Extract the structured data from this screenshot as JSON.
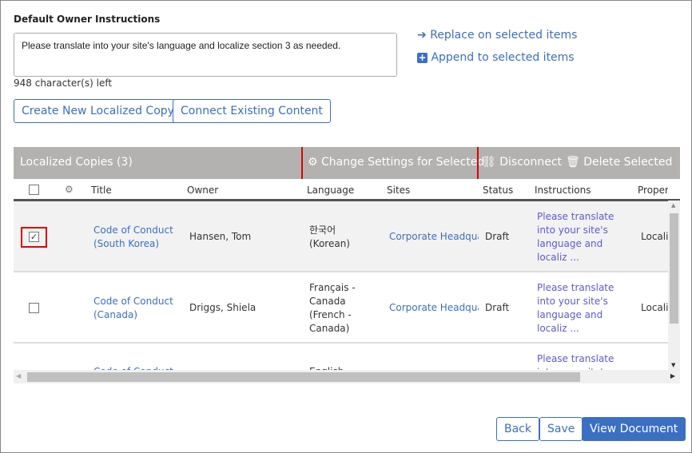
{
  "instructions": {
    "label": "Default Owner Instructions",
    "value": "Please translate into your site's language and localize section 3 as needed.",
    "chars_left": "948 character(s) left",
    "replace": "Replace on selected items",
    "append": "Append to selected items"
  },
  "buttons": {
    "create": "Create New Localized Copy",
    "connect": "Connect Existing Content",
    "back": "Back",
    "save": "Save",
    "view": "View Document"
  },
  "grid": {
    "title": "Localized Copies (3)",
    "change": "Change Settings for Selected",
    "disconnect": "Disconnect",
    "delete": "Delete Selected",
    "columns": [
      "Title",
      "Owner",
      "Language",
      "Sites",
      "Status",
      "Instructions",
      "Proper"
    ],
    "rows": [
      {
        "checked": true,
        "title": "Code of Conduct (South Korea)",
        "owner": "Hansen, Tom",
        "language": "한국어 (Korean)",
        "sites": "Corporate Headqua",
        "status": "Draft",
        "instructions": "Please translate into your site's language and localiz ...",
        "properties": "Locali"
      },
      {
        "checked": false,
        "title": "Code of Conduct (Canada)",
        "owner": "Driggs, Shiela",
        "language": "Français - Canada (French - Canada)",
        "sites": "Corporate Headqua",
        "status": "Draft",
        "instructions": "Please translate into your site's language and localiz ...",
        "properties": "Locali"
      },
      {
        "checked": false,
        "title": "Code of Conduct",
        "owner": "",
        "language": "English",
        "sites": "",
        "status": "",
        "instructions": "Please translate into your site's",
        "properties": ""
      }
    ]
  },
  "colors": {
    "accent": "#3b6fc4",
    "primary_button": "#3b6fc4",
    "highlight": "#e00000"
  }
}
